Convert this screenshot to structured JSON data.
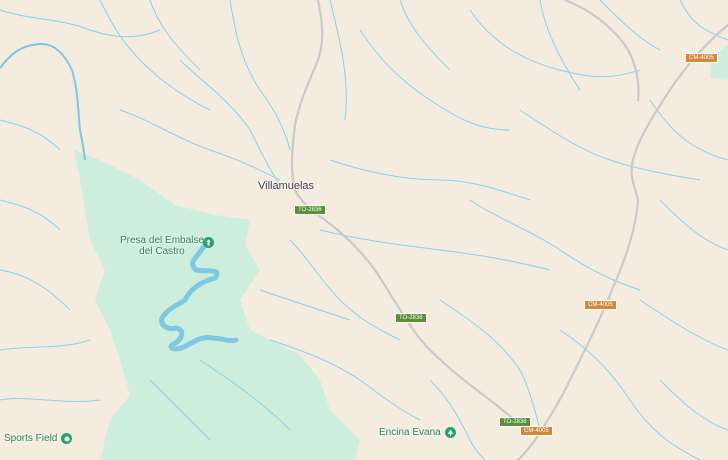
{
  "map": {
    "places": {
      "villamuelas": "Villamuelas"
    },
    "pois": {
      "presa_line1": "Presa del Embalse",
      "presa_line2": "del Castro",
      "sports_field": "Sports Field",
      "encina_evana": "Encina Evana"
    },
    "roads": {
      "to2836_a": "TO-2836",
      "to2836_b": "TO-2836",
      "to2836_c": "TO-2836",
      "cm4005_a": "CM-4005",
      "cm4005_b": "CM-4005",
      "cm4005_c": "CM-4005"
    },
    "colors": {
      "land": "#f4ecdf",
      "park": "#cdeedd",
      "water": "#7fc8e3",
      "road": "#c9c9c9",
      "stream": "#8ed0ea",
      "poi": "#26a172"
    }
  }
}
